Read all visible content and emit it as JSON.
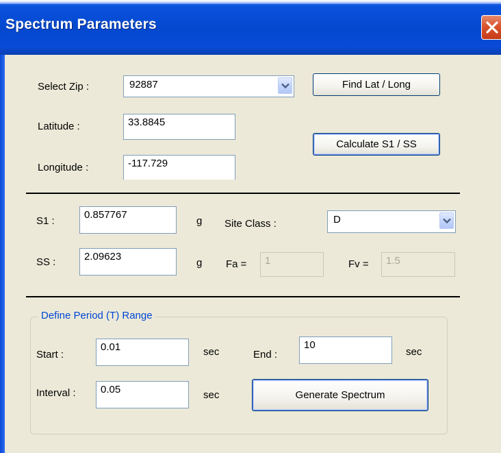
{
  "window": {
    "title": "Spectrum Parameters"
  },
  "location": {
    "zip_label": "Select Zip :",
    "zip_value": "92887",
    "find_button": "Find Lat / Long",
    "latitude_label": "Latitude :",
    "latitude_value": "33.8845",
    "longitude_label": "Longitude :",
    "longitude_value": "-117.729",
    "calculate_button": "Calculate S1 / SS"
  },
  "site": {
    "s1_label": "S1 :",
    "s1_value": "0.857767",
    "s1_unit": "g",
    "ss_label": "SS :",
    "ss_value": "2.09623",
    "ss_unit": "g",
    "site_class_label": "Site Class :",
    "site_class_value": "D",
    "fa_label": "Fa =",
    "fa_value": "1",
    "fv_label": "Fv =",
    "fv_value": "1.5"
  },
  "period": {
    "group_title": "Define Period (T) Range",
    "start_label": "Start :",
    "start_value": "0.01",
    "start_unit": "sec",
    "end_label": "End :",
    "end_value": "10",
    "end_unit": "sec",
    "interval_label": "Interval :",
    "interval_value": "0.05",
    "interval_unit": "sec",
    "generate_button": "Generate Spectrum"
  },
  "icons": {
    "close": "close-icon",
    "dropdown": "chevron-down-icon"
  },
  "colors": {
    "title_bar": "#0448cf",
    "close_button": "#d9532e",
    "group_title": "#0046d5",
    "dialog_background": "#ece9d8"
  }
}
